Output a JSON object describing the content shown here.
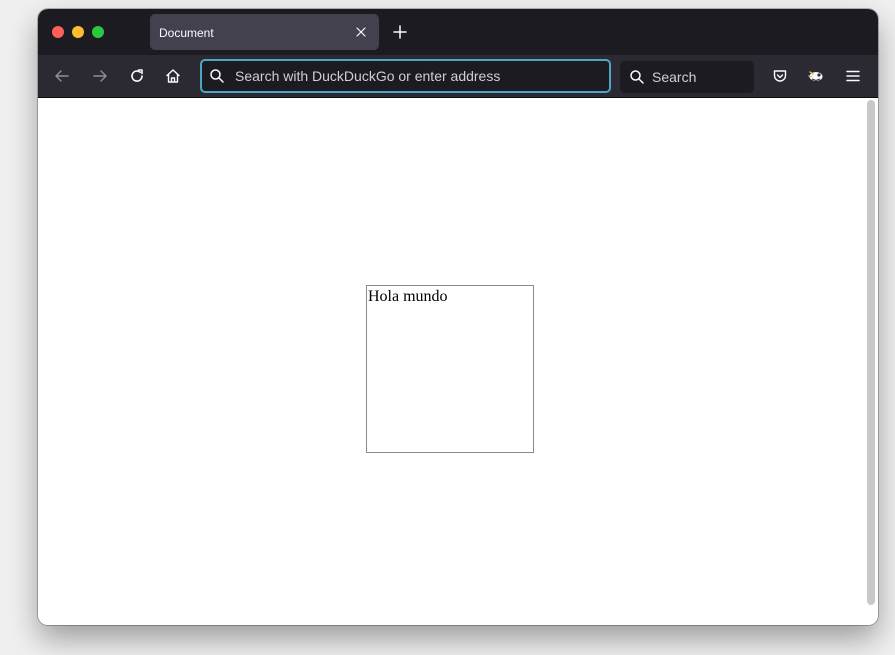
{
  "window": {
    "traffic_lights": {
      "close_color": "#ff5f57",
      "minimize_color": "#febc2e",
      "maximize_color": "#28c840"
    }
  },
  "tabs": [
    {
      "title": "Document",
      "active": true
    }
  ],
  "toolbar": {
    "icons": {
      "back": "arrow-left-icon",
      "forward": "arrow-right-icon",
      "reload": "reload-icon",
      "home": "home-icon",
      "pocket": "pocket-icon",
      "extension": "extension-icon",
      "menu": "hamburger-menu-icon"
    }
  },
  "urlbar": {
    "placeholder": "Search with DuckDuckGo or enter address",
    "value": ""
  },
  "searchbar": {
    "placeholder": "Search",
    "value": ""
  },
  "page": {
    "box_text": "Hola mundo"
  },
  "colors": {
    "titlebar": "#1c1b22",
    "toolbar": "#2b2a33",
    "tab_active": "#42414d",
    "urlbar_focus_border": "#4ca6c8",
    "page_background": "#ffffff"
  }
}
